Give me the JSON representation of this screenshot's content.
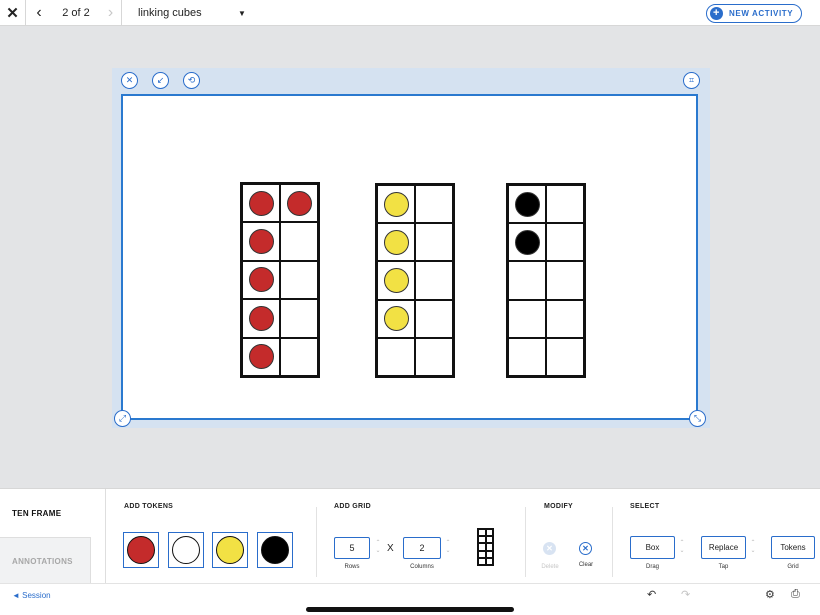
{
  "topbar": {
    "close_icon": "✕",
    "back_icon": "‹",
    "pager": "2 of 2",
    "forward_icon": "›",
    "title": "linking cubes",
    "title_caret": "▼",
    "new_activity_plus": "+",
    "new_activity_label": "NEW ACTIVITY"
  },
  "canvas_controls": {
    "close": "✕",
    "shrink": "↙",
    "rotate": "⟲",
    "crop": "⌗",
    "resize_left": "⤢",
    "resize_right": "⤡"
  },
  "frames": [
    {
      "color": "#c42b2b",
      "tokens": [
        [
          1,
          1
        ],
        [
          1,
          0
        ],
        [
          1,
          0
        ],
        [
          1,
          0
        ],
        [
          1,
          0
        ]
      ]
    },
    {
      "color": "#f2e144",
      "tokens": [
        [
          1,
          0
        ],
        [
          1,
          0
        ],
        [
          1,
          0
        ],
        [
          1,
          0
        ],
        [
          0,
          0
        ]
      ]
    },
    {
      "color": "#000000",
      "tokens": [
        [
          1,
          0
        ],
        [
          1,
          0
        ],
        [
          0,
          0
        ],
        [
          0,
          0
        ],
        [
          0,
          0
        ]
      ]
    }
  ],
  "panel": {
    "tabs": {
      "ten_frame": "TEN FRAME",
      "annotations": "ANNOTATIONS"
    },
    "add_tokens": {
      "title": "ADD TOKENS",
      "colors": [
        "#c42b2b",
        "#ffffff",
        "#f2e144",
        "#000000"
      ]
    },
    "add_grid": {
      "title": "ADD GRID",
      "rows_value": "5",
      "rows_label": "Rows",
      "times": "X",
      "columns_value": "2",
      "columns_label": "Columns"
    },
    "modify": {
      "title": "MODIFY",
      "delete_label": "Delete",
      "clear_label": "Clear",
      "delete_icon": "✕",
      "clear_icon": "✕"
    },
    "select": {
      "title": "SELECT",
      "drag_value": "Box",
      "drag_label": "Drag",
      "tap_value": "Replace",
      "tap_label": "Tap",
      "grid_value": "Tokens",
      "grid_label": "Grid"
    },
    "stepper_up": "⌃",
    "stepper_down": "⌄"
  },
  "footer": {
    "session": "◄ Session",
    "undo_icon": "↶",
    "redo_icon": "↷",
    "settings_icon": "⚙",
    "print_icon": "⎙"
  }
}
